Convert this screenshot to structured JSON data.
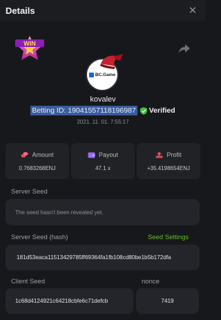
{
  "header": {
    "title": "Details",
    "close_icon": "close-icon"
  },
  "badge": {
    "text": "WIN",
    "icon": "win-star-badge"
  },
  "share": {
    "icon": "share-icon"
  },
  "avatar": {
    "logo_text": "BC.Game",
    "hat_icon": "red-hat-icon"
  },
  "user": {
    "name": "kovalev",
    "betting_id": "Betting ID: 19041557118196987",
    "verified_label": "Verified",
    "timestamp": "2021. 11. 01. 7:55:17"
  },
  "stats": [
    {
      "label": "Amount",
      "value": "0.7683268ENJ",
      "icon": "coins-icon",
      "color": "#e64b5a"
    },
    {
      "label": "Payout",
      "value": "47.1 x",
      "icon": "wallet-icon",
      "color": "#9b6bff"
    },
    {
      "label": "Profit",
      "value": "+35.4198654ENJ",
      "icon": "profit-icon",
      "color": "#e64b5a"
    }
  ],
  "server_seed": {
    "label": "Server Seed",
    "value": "The seed hasn't been revealed yet."
  },
  "server_seed_hash": {
    "label": "Server Seed (hash)",
    "settings_link": "Seed Settings",
    "value": "181d53eaca11513429785ff69364fa1fb108cd80be1b5b172dfa"
  },
  "client_seed": {
    "label": "Client Seed",
    "value": "1c68d4124921c64218cbfe6c71defcb"
  },
  "nonce": {
    "label": "nonce",
    "value": "7419"
  },
  "colors": {
    "accent_green": "#6bbf27",
    "background": "#17181b",
    "panel": "#23252a"
  }
}
